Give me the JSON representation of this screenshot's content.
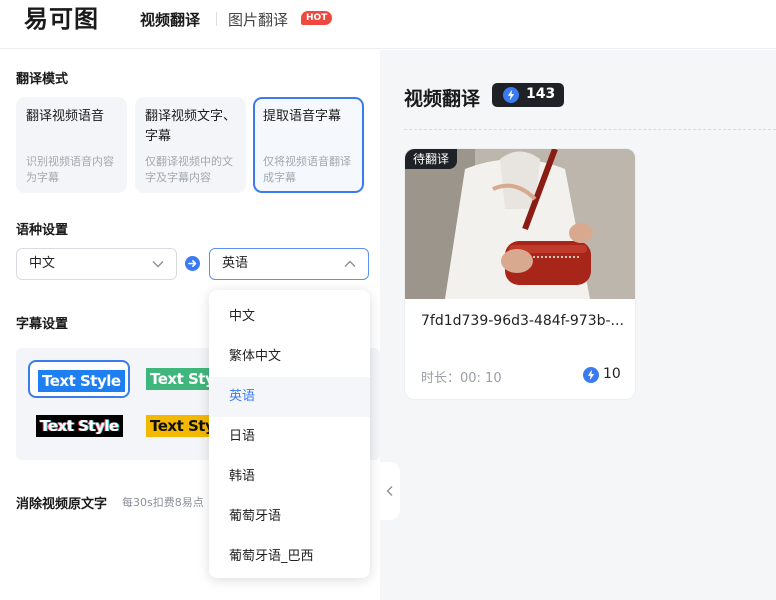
{
  "header": {
    "logo_text": "易可图",
    "nav_video": "视频翻译",
    "nav_image": "图片翻译",
    "nav_hot": "HOT"
  },
  "left": {
    "mode_title": "翻译模式",
    "modes": [
      {
        "title": "翻译视频语音",
        "desc": "识别视频语音内容为字幕",
        "active": false
      },
      {
        "title": "翻译视频文字、字幕",
        "desc": "仅翻译视频中的文字及字幕内容",
        "active": false
      },
      {
        "title": "提取语音字幕",
        "desc": "仅将视频语音翻译成字幕",
        "active": true
      }
    ],
    "lang_title": "语种设置",
    "source_lang": "中文",
    "target_lang": "英语",
    "subtitle_title": "字幕设置",
    "text_styles": [
      "Text Style",
      "Text Style",
      "Text Style",
      "Text Style"
    ],
    "erase_title": "消除视频原文字",
    "erase_note": "每30s扣费8易点"
  },
  "dropdown": {
    "options": [
      "中文",
      "繁体中文",
      "英语",
      "日语",
      "韩语",
      "葡萄牙语",
      "葡萄牙语_巴西"
    ],
    "selected": "英语"
  },
  "right": {
    "title": "视频翻译",
    "credits": "143",
    "card": {
      "status": "待翻译",
      "name": "7fd1d739-96d3-484f-973b-...",
      "duration": "时长：00: 10",
      "cost": "10"
    }
  },
  "colors": {
    "accent": "#3a7bf0",
    "hot": "#f0483e",
    "dark_badge": "#1e2226"
  }
}
